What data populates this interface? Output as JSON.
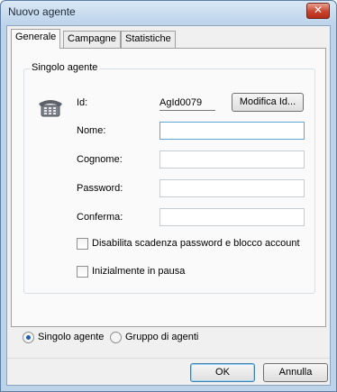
{
  "window": {
    "title": "Nuovo agente",
    "close_glyph": "✕"
  },
  "tabs": [
    {
      "label": "Generale",
      "active": true
    },
    {
      "label": "Campagne",
      "active": false
    },
    {
      "label": "Statistiche",
      "active": false
    }
  ],
  "group": {
    "title": "Singolo agente",
    "icon": "telephone-icon",
    "id_label": "Id:",
    "id_value": "AgId0079",
    "modify_button": "Modifica Id...",
    "fields": [
      {
        "label": "Nome:",
        "value": ""
      },
      {
        "label": "Cognome:",
        "value": ""
      },
      {
        "label": "Password:",
        "value": ""
      },
      {
        "label": "Conferma:",
        "value": ""
      }
    ],
    "checkboxes": [
      {
        "label": "Disabilita scadenza password e blocco account",
        "checked": false
      },
      {
        "label": "Inizialmente in pausa",
        "checked": false
      }
    ]
  },
  "radio": [
    {
      "label": "Singolo agente",
      "selected": true
    },
    {
      "label": "Gruppo di agenti",
      "selected": false
    }
  ],
  "buttons": {
    "ok": "OK",
    "cancel": "Annulla"
  },
  "colors": {
    "accent": "#3c7fb1",
    "frame": "#bcd3ea",
    "close": "#c8442c"
  }
}
